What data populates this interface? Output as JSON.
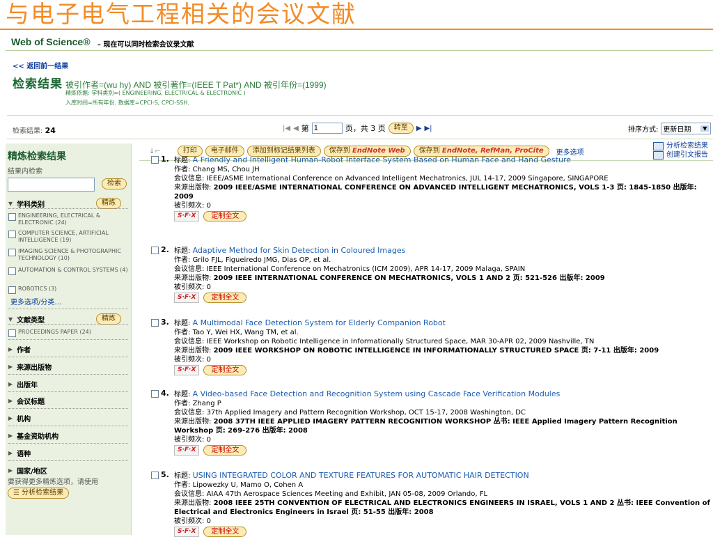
{
  "slide_title": "与电子电气工程相关的会议文献",
  "header": {
    "logo": "Web of Science®",
    "subtitle": "– 现在可以同时检索会议录文献"
  },
  "back_link": "<< 返回前一结果",
  "results_heading": "检索结果",
  "query_line": "被引作者=(wu hy) AND 被引著作=(IEEE T Pat*) AND 被引年份=(1999)",
  "query_refine": "精炼依据: 学科类别=( ENGINEERING, ELECTRICAL & ELECTRONIC )",
  "query_db": "入库时间=所有年份. 数据库=CPCI-S, CPCI-SSH.",
  "count_label": "检索结果:",
  "count_value": "24",
  "pager": {
    "first": "|◀",
    "prev": "◀",
    "page_label": "第",
    "page_value": "1",
    "of_label": "页，共 3 页",
    "go": "转至",
    "next": "▶",
    "last": "▶|"
  },
  "sort": {
    "label": "排序方式:",
    "value": "更新日期"
  },
  "sidebar": {
    "title": "精炼检索结果",
    "within": "结果内检索",
    "search_btn": "检索",
    "refine_btn": "精炼",
    "subject": {
      "label": "学科类别",
      "items": [
        "ENGINEERING, ELECTRICAL & ELECTRONIC (24)",
        "COMPUTER SCIENCE, ARTIFICIAL INTELLIGENCE (19)",
        "IMAGING SCIENCE & PHOTOGRAPHIC TECHNOLOGY (10)",
        "AUTOMATION & CONTROL SYSTEMS (4)",
        "ROBOTICS (3)"
      ],
      "more": "更多选项/分类…"
    },
    "doctype": {
      "label": "文献类型",
      "items": [
        "PROCEEDINGS PAPER (24)"
      ]
    },
    "collapsed": [
      "作者",
      "来源出版物",
      "出版年",
      "会议标题",
      "机构",
      "基金资助机构",
      "语种",
      "国家/地区"
    ],
    "note": "要获得更多精炼选项，请使用",
    "analyze_btn": "☰ 分析检索结果"
  },
  "toolbar": {
    "print": "打印",
    "email": "电子邮件",
    "add_list": "添加到标记结果列表",
    "save_en_prefix": "保存到",
    "save_en_brand": "EndNote Web",
    "save_multi_prefix": "保存到",
    "save_multi_brand": "EndNote, RefMan, ProCite",
    "more": "更多选项",
    "analyze": "分析检索结果",
    "citation_report": "创建引文报告"
  },
  "labels": {
    "title": "标题:",
    "author": "作者:",
    "conf": "会议信息:",
    "source": "来源出版物:",
    "cited": "被引频次:",
    "fulltext": "定制全文",
    "sfx": "S·F·X"
  },
  "records": [
    {
      "num": "1.",
      "title": "A Friendly and Intelligent Human-Robot Interface System Based on Human Face and Hand Gesture",
      "authors": "Chang MS, Chou JH",
      "conf": "IEEE/ASME International Conference on Advanced Intelligent Mechatronics, JUL 14-17, 2009 Singapore, SINGAPORE",
      "source": "2009 IEEE/ASME INTERNATIONAL CONFERENCE ON ADVANCED INTELLIGENT MECHATRONICS, VOLS 1-3  页: 1845-1850  出版年: 2009",
      "cited": "0"
    },
    {
      "num": "2.",
      "title": "Adaptive Method for Skin Detection in Coloured Images",
      "authors": "Grilo FJL, Figueiredo JMG, Dias OP, et al.",
      "conf": "IEEE International Conference on Mechatronics (ICM 2009), APR 14-17, 2009 Malaga, SPAIN",
      "source": "2009 IEEE INTERNATIONAL CONFERENCE ON MECHATRONICS, VOLS 1 AND 2  页: 521-526  出版年: 2009",
      "cited": "0"
    },
    {
      "num": "3.",
      "title": "A Multimodal Face Detection System for Elderly Companion Robot",
      "authors": "Tao Y, Wei HX, Wang TM, et al.",
      "conf": "IEEE Workshop on Robotic Intelligence in Informationally Structured Space, MAR 30-APR 02, 2009 Nashville, TN",
      "source": "2009 IEEE WORKSHOP ON ROBOTIC INTELLIGENCE IN INFORMATIONALLY STRUCTURED SPACE  页: 7-11  出版年: 2009",
      "cited": "0"
    },
    {
      "num": "4.",
      "title": "A Video-based Face Detection and Recognition System using Cascade Face Verification Modules",
      "authors": "Zhang P",
      "conf": "37th Applied Imagery and Pattern Recognition Workshop, OCT 15-17, 2008 Washington, DC",
      "source": "2008 37TH IEEE APPLIED IMAGERY PATTERN RECOGNITION WORKSHOP 丛书: IEEE Applied Imagery Pattern Recognition Workshop  页: 269-276  出版年: 2008",
      "cited": "0"
    },
    {
      "num": "5.",
      "title": "USING INTEGRATED COLOR AND TEXTURE FEATURES FOR AUTOMATIC HAIR DETECTION",
      "authors": "Lipowezky U, Mamo O, Cohen A",
      "conf": "AIAA 47th Aerospace Sciences Meeting and Exhibit, JAN 05-08, 2009 Orlando, FL",
      "source": "2008 IEEE 25TH CONVENTION OF ELECTRICAL AND ELECTRONICS ENGINEERS IN ISRAEL, VOLS 1 AND 2 丛书: IEEE Convention of Electrical and Electronics Engineers in Israel  页: 51-55  出版年: 2008",
      "cited": "0"
    }
  ]
}
